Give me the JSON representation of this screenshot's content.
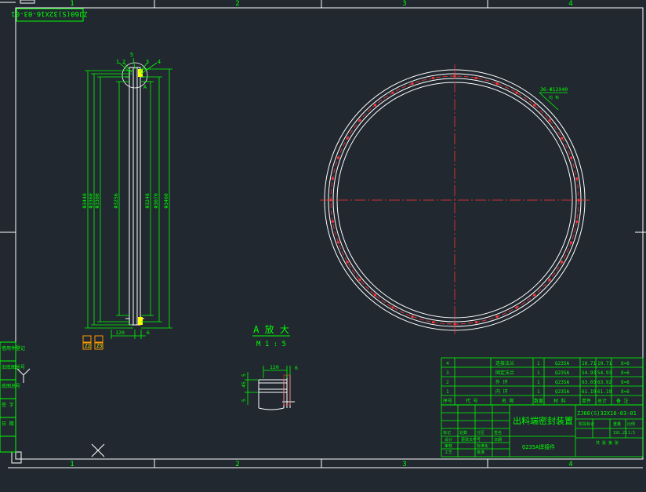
{
  "colors": {
    "background": "#212830",
    "line": "#ffffff",
    "dimension": "#00ff00",
    "centerline": "#ff3333",
    "table": "#00ff00",
    "accent": "#ffff00"
  },
  "frame": {
    "zones_top": [
      "1",
      "2",
      "3",
      "4"
    ],
    "zones_bottom": [
      "1",
      "2",
      "3",
      "4"
    ],
    "drawing_code_rotated": "ZJ60(S)32X16-03-01"
  },
  "elevation": {
    "balloons": [
      "1",
      "2",
      "3",
      "4"
    ],
    "extra_balloon": "5",
    "detail_marker": "A",
    "dims_left": [
      "Φ3440",
      "Φ3360",
      "Φ3300",
      "Φ3256"
    ],
    "dims_right": [
      "Φ3248",
      "Φ3070",
      "Φ3460"
    ],
    "bottom_dim": "120",
    "bottom_dim_right": "6",
    "tags": [
      "Z2",
      "Z3"
    ]
  },
  "plan": {
    "hole_note": "36-Φ12X40",
    "hole_note_sub": "均 布"
  },
  "detail": {
    "title": "A 放 大",
    "scale": "M 1 : 5",
    "dim_width": "120",
    "dim_right": "6",
    "dim_left_a": "5",
    "dim_left_b": "45",
    "dim_left_c": "5"
  },
  "parts_table": {
    "headers": [
      "序号",
      "代 号",
      "名 称",
      "数量",
      "材 料",
      "单件",
      "总计",
      "备 注"
    ],
    "rows": [
      {
        "no": "4",
        "code": "",
        "name": "连接法兰",
        "qty": "1",
        "material": "Q235A",
        "unit": "10.71",
        "total": "10.71",
        "note": "δ=6"
      },
      {
        "no": "3",
        "code": "",
        "name": "固定法兰",
        "qty": "1",
        "material": "Q235A",
        "unit": "54.93",
        "total": "54.93",
        "note": "δ=6"
      },
      {
        "no": "2",
        "code": "",
        "name": "外 环",
        "qty": "1",
        "material": "Q235A",
        "unit": "63.03",
        "total": "63.92",
        "note": "δ=6"
      },
      {
        "no": "1",
        "code": "",
        "name": "内 环",
        "qty": "1",
        "material": "Q235A",
        "unit": "61.19",
        "total": "61.19",
        "note": "δ=6"
      }
    ]
  },
  "title_block": {
    "drawing_no": "ZJ60(S)32X16-03-01",
    "title": "出料端密封装置",
    "material": "Q235A焊接件",
    "small_labels": [
      "标记",
      "处数",
      "分区",
      "更改文件号",
      "签名",
      "日期"
    ],
    "role_labels": [
      "设计",
      "审核",
      "工艺",
      "标准化",
      "批准"
    ],
    "stage_labels": [
      "阶段标记",
      "重量",
      "比例"
    ],
    "weight": "191.25",
    "scale": "1:5",
    "sheet": "共 张 第 张"
  },
  "left_strip": [
    "借用件登记",
    "旧底图总号",
    "底图总号",
    "签 字",
    "日 期"
  ]
}
